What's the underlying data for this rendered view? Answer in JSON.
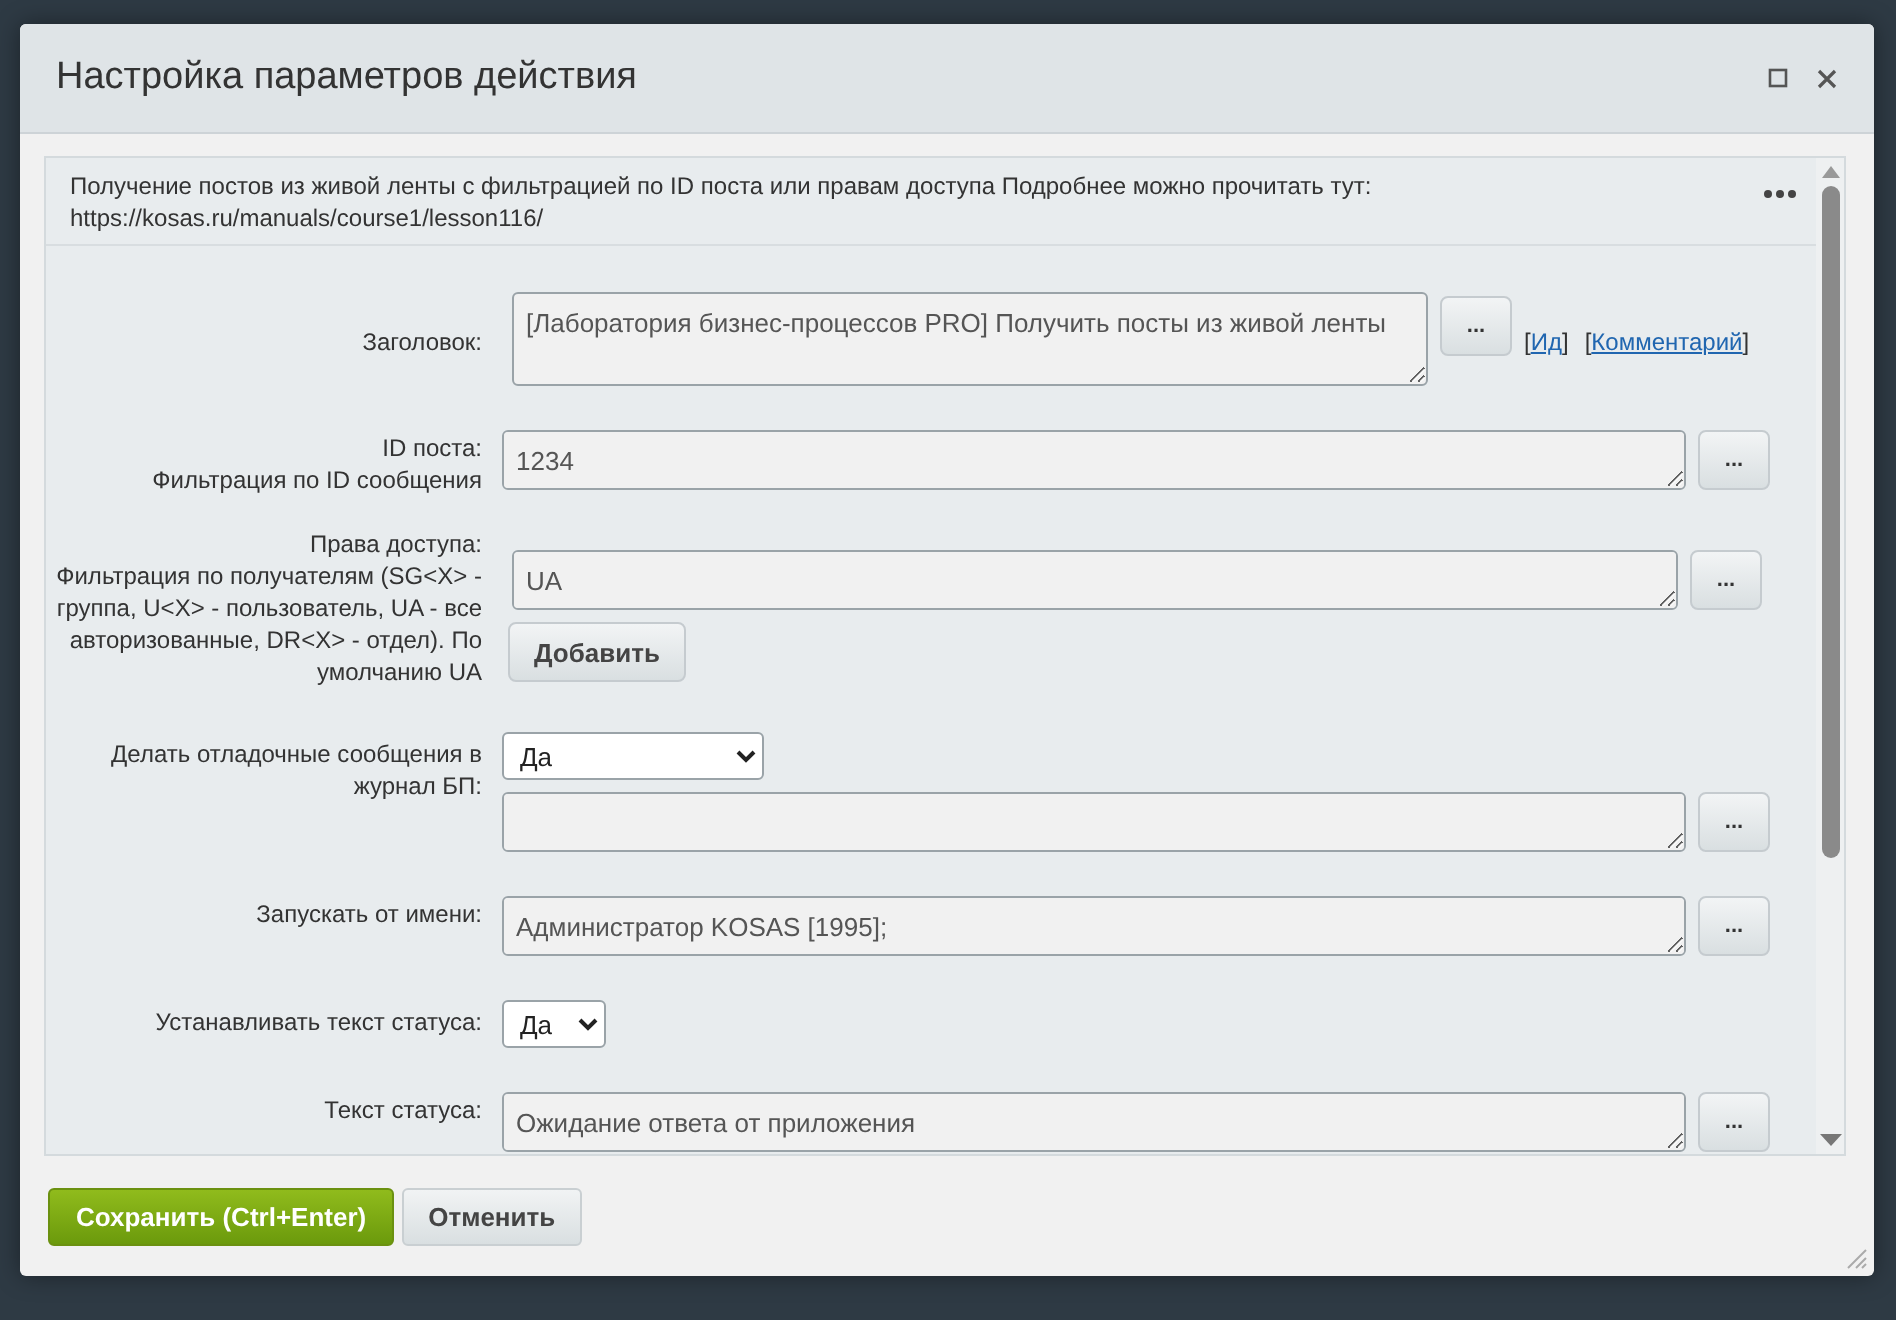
{
  "window": {
    "title": "Настройка параметров действия"
  },
  "description": {
    "text": "Получение постов из живой ленты с фильтрацией по ID поста или правам доступа Подробнее можно прочитать тут: https://kosas.ru/manuals/course1/lesson116/"
  },
  "fields": [
    {
      "kind": "title",
      "label": [
        "Заголовок:"
      ],
      "value": "[Лаборатория бизнес-процессов PRO] Получить посты из живой ленты",
      "button": "...",
      "links": [
        {
          "before": "[",
          "text": "Ид",
          "after": "]"
        },
        {
          "before": "[",
          "text": "Комментарий",
          "after": "]"
        }
      ]
    },
    {
      "kind": "textarea",
      "label": [
        "ID поста:",
        "Фильтрация по ID сообщения"
      ],
      "value": "1234",
      "button": "..."
    },
    {
      "kind": "textarea",
      "label": [
        "Права доступа:",
        "Фильтрация по получателям (SG<X> - группа, U<X> - пользователь, UA - все авторизованные, DR<X> - отдел). По умолчанию UA"
      ],
      "value": "UA",
      "button": "...",
      "add_button": "Добавить"
    },
    {
      "kind": "select_textarea",
      "label": [
        "Делать отладочные сообщения в журнал БП:"
      ],
      "select": "Да",
      "button": "..."
    },
    {
      "kind": "textarea",
      "label": [
        "Запускать от имени:"
      ],
      "value": "Администратор KOSAS [1995];",
      "button": "..."
    },
    {
      "kind": "select_small",
      "label": [
        "Устанавливать текст статуса:"
      ],
      "select": "Да"
    },
    {
      "kind": "textarea",
      "label": [
        "Текст статуса:"
      ],
      "value": "Ожидание ответа от приложения",
      "button": "..."
    }
  ],
  "buttons": [
    {
      "label": "Сохранить (Ctrl+Enter)",
      "kind": "primary"
    },
    {
      "label": "Отменить",
      "kind": "secondary"
    }
  ]
}
